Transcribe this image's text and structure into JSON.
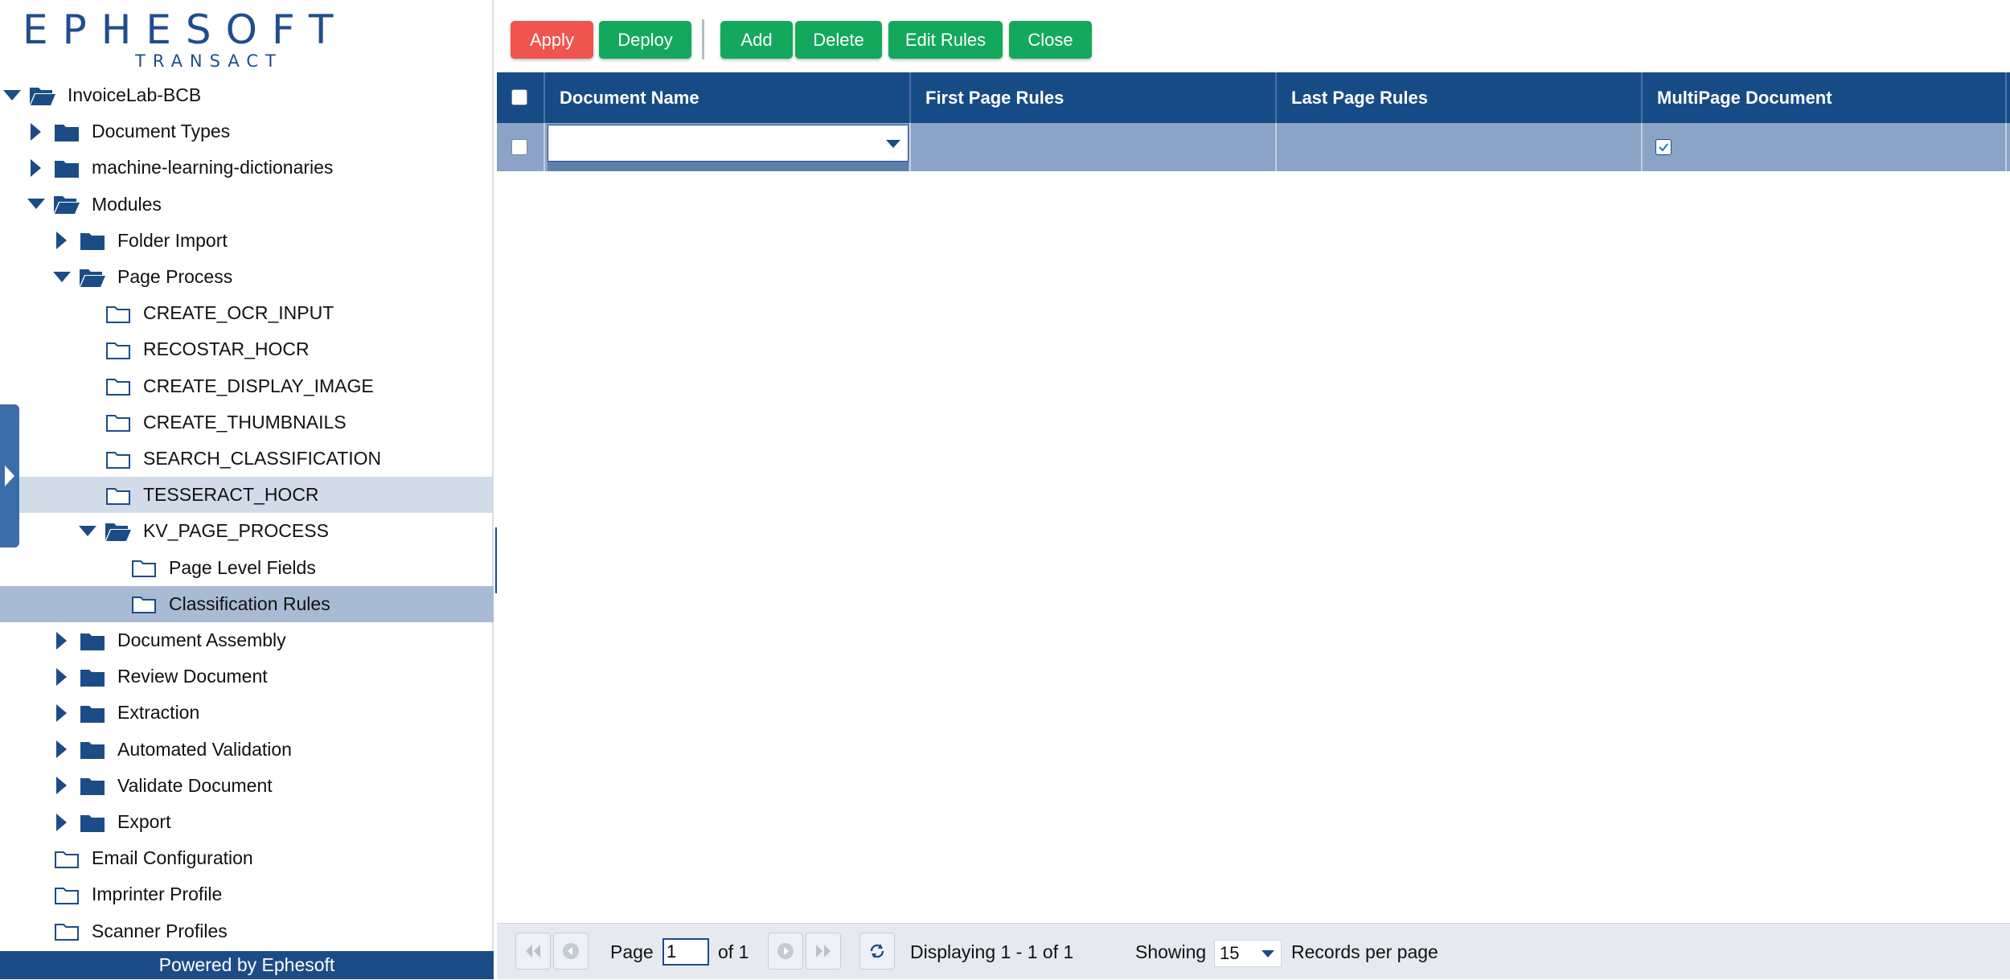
{
  "logo": {
    "word": "EPHESOFT",
    "sub": "TRANSACT"
  },
  "toolbar": {
    "apply": "Apply",
    "deploy": "Deploy",
    "add": "Add",
    "delete": "Delete",
    "edit_rules": "Edit Rules",
    "close": "Close"
  },
  "tree": [
    {
      "label": "InvoiceLab-BCB",
      "level": 0,
      "state": "expanded",
      "icon": "folder-open-icon"
    },
    {
      "label": "Document Types",
      "level": 1,
      "state": "collapsed",
      "icon": "folder-icon"
    },
    {
      "label": "machine-learning-dictionaries",
      "level": 1,
      "state": "collapsed",
      "icon": "folder-icon"
    },
    {
      "label": "Modules",
      "level": 1,
      "state": "expanded",
      "icon": "folder-open-icon"
    },
    {
      "label": "Folder Import",
      "level": 2,
      "state": "collapsed",
      "icon": "folder-icon"
    },
    {
      "label": "Page Process",
      "level": 2,
      "state": "expanded",
      "icon": "folder-open-icon"
    },
    {
      "label": "CREATE_OCR_INPUT",
      "level": 3,
      "state": "leaf",
      "icon": "folder-outline-icon"
    },
    {
      "label": "RECOSTAR_HOCR",
      "level": 3,
      "state": "leaf",
      "icon": "folder-outline-icon"
    },
    {
      "label": "CREATE_DISPLAY_IMAGE",
      "level": 3,
      "state": "leaf",
      "icon": "folder-outline-icon"
    },
    {
      "label": "CREATE_THUMBNAILS",
      "level": 3,
      "state": "leaf",
      "icon": "folder-outline-icon"
    },
    {
      "label": "SEARCH_CLASSIFICATION",
      "level": 3,
      "state": "leaf",
      "icon": "folder-outline-icon"
    },
    {
      "label": "TESSERACT_HOCR",
      "level": 3,
      "state": "leaf",
      "icon": "folder-outline-icon",
      "highlight": "hover"
    },
    {
      "label": "KV_PAGE_PROCESS",
      "level": 3,
      "state": "expanded",
      "icon": "folder-open-icon"
    },
    {
      "label": "Page Level Fields",
      "level": 4,
      "state": "leaf",
      "icon": "folder-outline-icon"
    },
    {
      "label": "Classification Rules",
      "level": 4,
      "state": "leaf",
      "icon": "folder-outline-icon",
      "highlight": "selected"
    },
    {
      "label": "Document Assembly",
      "level": 2,
      "state": "collapsed",
      "icon": "folder-icon"
    },
    {
      "label": "Review Document",
      "level": 2,
      "state": "collapsed",
      "icon": "folder-icon"
    },
    {
      "label": "Extraction",
      "level": 2,
      "state": "collapsed",
      "icon": "folder-icon"
    },
    {
      "label": "Automated Validation",
      "level": 2,
      "state": "collapsed",
      "icon": "folder-icon"
    },
    {
      "label": "Validate Document",
      "level": 2,
      "state": "collapsed",
      "icon": "folder-icon"
    },
    {
      "label": "Export",
      "level": 2,
      "state": "collapsed",
      "icon": "folder-icon"
    },
    {
      "label": "Email Configuration",
      "level": 1,
      "state": "leaf",
      "icon": "folder-outline-icon"
    },
    {
      "label": "Imprinter Profile",
      "level": 1,
      "state": "leaf",
      "icon": "folder-outline-icon"
    },
    {
      "label": "Scanner Profiles",
      "level": 1,
      "state": "leaf",
      "icon": "folder-outline-icon"
    }
  ],
  "footer": "Powered by Ephesoft",
  "grid": {
    "columns": [
      "Document Name",
      "First Page Rules",
      "Last Page Rules",
      "MultiPage Document"
    ],
    "rows": [
      {
        "document_name": "",
        "first_page_rules": "",
        "last_page_rules": "",
        "multipage": true
      }
    ]
  },
  "pager": {
    "page_label": "Page",
    "page_value": "1",
    "of_label": "of 1",
    "displaying": "Displaying 1 - 1 of 1",
    "showing": "Showing",
    "per_page": "15",
    "records_label": "Records per page"
  },
  "colors": {
    "brand": "#1c4c86",
    "header": "#174b86",
    "apply": "#f0544f",
    "action": "#14a85c",
    "row": "#8aa3c7",
    "selected_node": "#a9bbd3",
    "hover_node": "#d2dce8"
  }
}
